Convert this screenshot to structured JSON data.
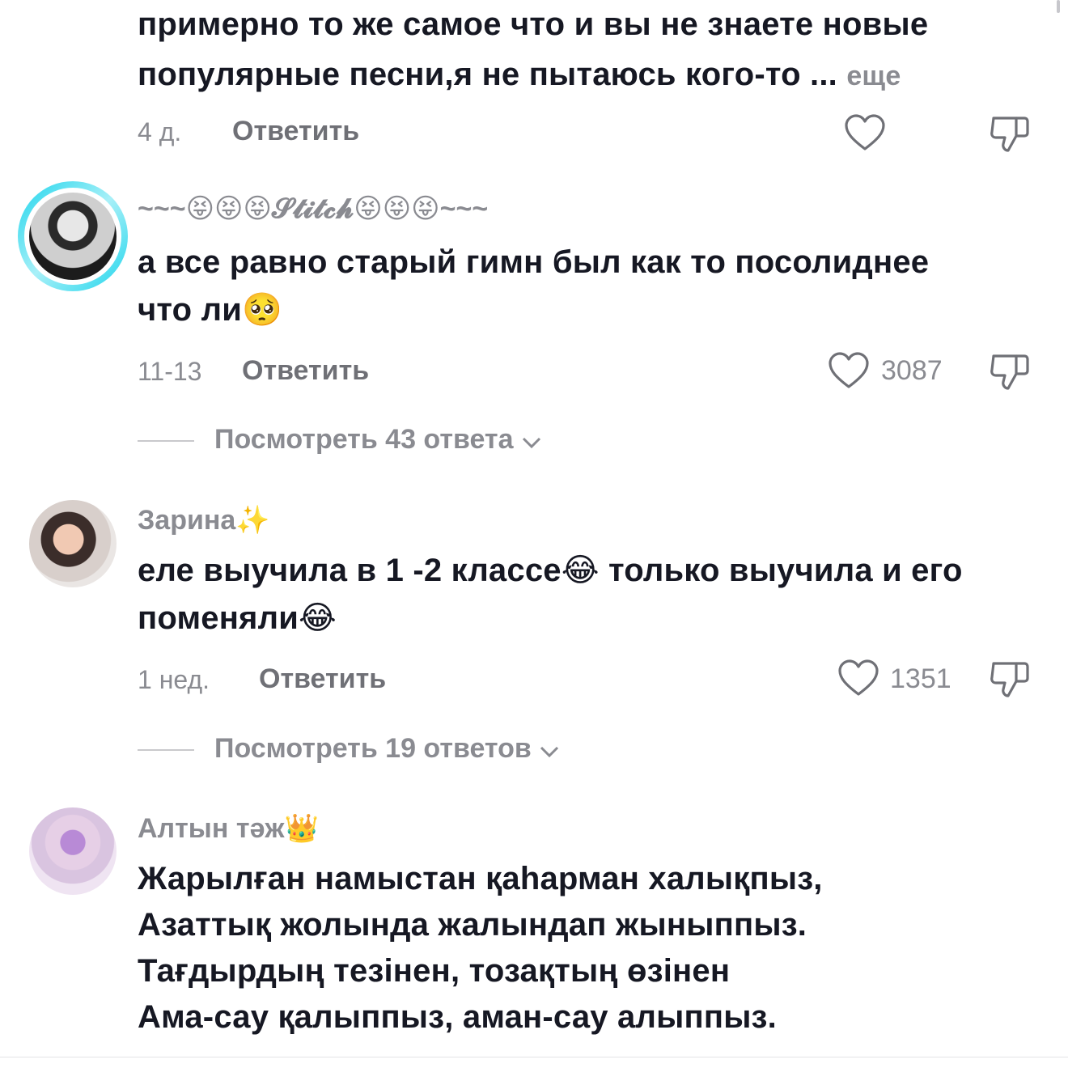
{
  "comments": [
    {
      "text_lines": [
        "примерно то же самое что и вы не знаете новые",
        "популярные песни,я не пытаюсь кого-то ..."
      ],
      "more_label": "еще",
      "time": "4 д.",
      "reply_label": "Ответить",
      "likes": ""
    },
    {
      "username": "~~~😝😝😝𝓢𝓽𝓲𝓽𝓬𝓱😝😝😝~~~",
      "text_lines": [
        "а все равно старый гимн был как то посолиднее",
        "что ли🥺"
      ],
      "time": "11-13",
      "reply_label": "Ответить",
      "likes": "3087",
      "view_replies": "Посмотреть 43 ответа"
    },
    {
      "username": "Зарина✨",
      "text_lines": [
        "еле выучила в 1 -2 классе😂 только выучила и его",
        "поменяли😂"
      ],
      "time": "1 нед.",
      "reply_label": "Ответить",
      "likes": "1351",
      "view_replies": "Посмотреть 19 ответов"
    },
    {
      "username": "Алтын тәж👑",
      "text_lines": [
        "Жарылған намыстан қаһарман халықпыз,",
        "Азаттық жолында жалындап жыныппыз.",
        "Тағдырдың тезінен, тозақтың өзінен",
        "Ама-сау қалыппыз, аман-сау алыппыз."
      ]
    }
  ],
  "icons": {
    "like": "heart-outline-icon",
    "dislike": "thumbs-down-icon",
    "chevron": "chevron-down-icon"
  },
  "colors": {
    "text": "#161823",
    "muted": "#8a8b91",
    "story_ring_start": "#20d5ec",
    "story_ring_end": "#8be9f5"
  }
}
